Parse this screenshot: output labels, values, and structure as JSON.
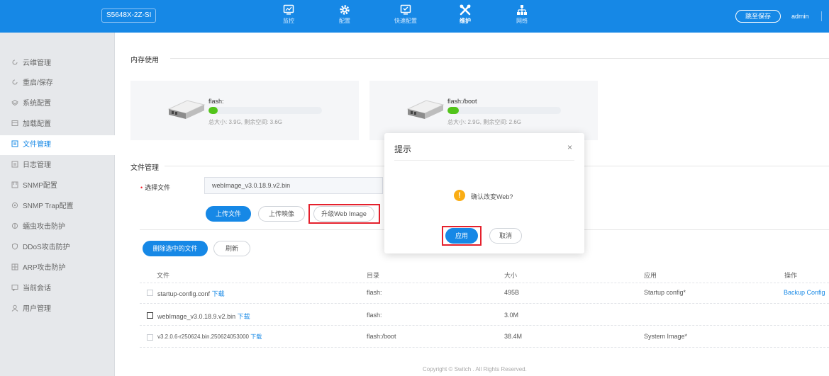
{
  "header": {
    "device": "S5648X-2Z-SI",
    "nav": [
      {
        "label": "监控",
        "icon": "monitor-icon"
      },
      {
        "label": "配置",
        "icon": "gear-icon"
      },
      {
        "label": "快速配置",
        "icon": "quick-config-icon"
      },
      {
        "label": "维护",
        "icon": "tools-icon",
        "active": true
      },
      {
        "label": "网络",
        "icon": "network-icon"
      }
    ],
    "save_label": "跳至保存",
    "user": "admin"
  },
  "sidebar": {
    "items": [
      {
        "label": "云维管理",
        "icon": "cloud-refresh-icon"
      },
      {
        "label": "重启/保存",
        "icon": "restart-icon"
      },
      {
        "label": "系统配置",
        "icon": "system-config-icon"
      },
      {
        "label": "加载配置",
        "icon": "load-config-icon"
      },
      {
        "label": "文件管理",
        "icon": "file-manage-icon",
        "active": true
      },
      {
        "label": "日志管理",
        "icon": "log-icon"
      },
      {
        "label": "SNMP配置",
        "icon": "snmp-icon"
      },
      {
        "label": "SNMP Trap配置",
        "icon": "snmp-trap-icon"
      },
      {
        "label": "蠕虫攻击防护",
        "icon": "worm-shield-icon"
      },
      {
        "label": "DDoS攻击防护",
        "icon": "ddos-shield-icon"
      },
      {
        "label": "ARP攻击防护",
        "icon": "arp-shield-icon"
      },
      {
        "label": "当前会话",
        "icon": "session-icon"
      },
      {
        "label": "用户管理",
        "icon": "user-icon"
      }
    ]
  },
  "memory": {
    "title": "内存使用",
    "cards": [
      {
        "name": "flash:",
        "info": "总大小: 3.9G, 剩余空间: 3.6G",
        "used_fraction": 0.08
      },
      {
        "name": "flash:/boot",
        "info": "总大小: 2.9G, 剩余空间: 2.6G",
        "used_fraction": 0.1
      }
    ]
  },
  "file_manage": {
    "title": "文件管理",
    "select_label": "选择文件",
    "file_value": "webImage_v3.0.18.9.v2.bin",
    "upload_file": "上传文件",
    "upload_image": "上传映像",
    "upgrade_web": "升级Web Image",
    "delete_selected": "删除选中的文件",
    "refresh": "刷新"
  },
  "table": {
    "headers": [
      "文件",
      "目录",
      "大小",
      "应用",
      "操作"
    ],
    "rows": [
      {
        "file": "startup-config.conf",
        "download": "下载",
        "dir": "flash:",
        "size": "495B",
        "app": "Startup config*",
        "action": "Backup Config"
      },
      {
        "file": "webImage_v3.0.18.9.v2.bin",
        "download": "下载",
        "dir": "flash:",
        "size": "3.0M",
        "app": "",
        "action": ""
      },
      {
        "file": "v3.2.0.6-r250624.bin.250624053000",
        "download": "下载",
        "dir": "flash:/boot",
        "size": "38.4M",
        "app": "System Image*",
        "action": ""
      }
    ]
  },
  "dialog": {
    "title": "提示",
    "close": "×",
    "message": "确认改变Web?",
    "apply": "应用",
    "cancel": "取消"
  },
  "footer": "Copyright © Switch . All Rights Reserved.",
  "colors": {
    "primary": "#1688e6",
    "highlight": "#e5202c",
    "progress": "#52c41a",
    "warning": "#faad14"
  }
}
